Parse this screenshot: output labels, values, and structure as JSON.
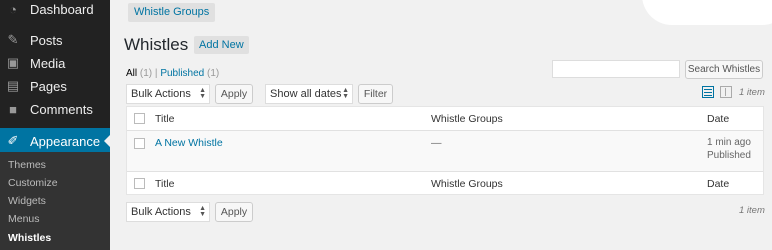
{
  "sidebar": {
    "menu": [
      {
        "label": "Dashboard",
        "icon": "dashboard-icon"
      },
      {
        "label": "Posts",
        "icon": "pin-icon"
      },
      {
        "label": "Media",
        "icon": "media-icon"
      },
      {
        "label": "Pages",
        "icon": "pages-icon"
      },
      {
        "label": "Comments",
        "icon": "comments-icon"
      },
      {
        "label": "Appearance",
        "icon": "paintbrush-icon",
        "current": true
      }
    ],
    "submenu": [
      {
        "label": "Themes"
      },
      {
        "label": "Customize"
      },
      {
        "label": "Widgets"
      },
      {
        "label": "Menus"
      },
      {
        "label": "Whistles",
        "current": true
      }
    ]
  },
  "header": {
    "tab": "Whistle Groups",
    "title": "Whistles",
    "add_new": "Add New"
  },
  "filters": {
    "all": "All",
    "all_count": "(1)",
    "separator": "|",
    "published": "Published",
    "published_count": "(1)"
  },
  "search": {
    "value": "",
    "button": "Search Whistles"
  },
  "toolbar_top": {
    "bulk_actions": "Bulk Actions",
    "apply": "Apply",
    "dates": "Show all dates",
    "filter": "Filter",
    "items": "1 item"
  },
  "table": {
    "columns": [
      "Title",
      "Whistle Groups",
      "Date"
    ],
    "rows": [
      {
        "title": "A New Whistle",
        "groups": "—",
        "date": "1 min ago",
        "status": "Published"
      }
    ]
  },
  "toolbar_bottom": {
    "bulk_actions": "Bulk Actions",
    "apply": "Apply",
    "items": "1 item"
  },
  "colors": {
    "accent": "#0074a2",
    "sidebar": "#222222",
    "background": "#f1f1f1"
  }
}
